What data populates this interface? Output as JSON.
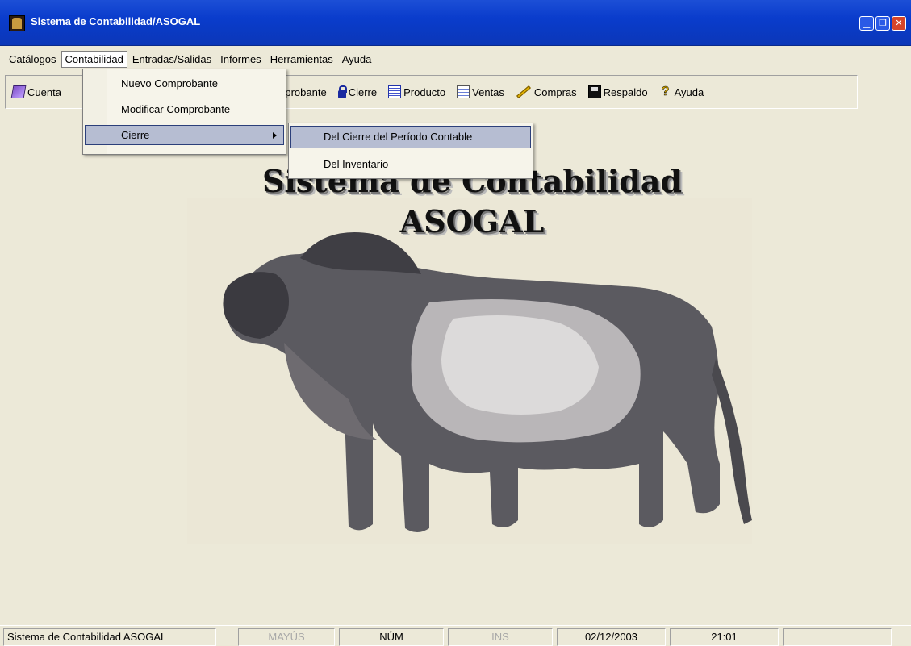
{
  "window": {
    "title": "Sistema de Contabilidad/ASOGAL",
    "buttons": [
      "▁",
      "❐",
      "✕"
    ]
  },
  "menubar": {
    "items": [
      {
        "label": "Catálogos"
      },
      {
        "label": "Contabilidad",
        "active": true
      },
      {
        "label": "Entradas/Salidas"
      },
      {
        "label": "Informes"
      },
      {
        "label": "Herramientas"
      },
      {
        "label": "Ayuda"
      }
    ]
  },
  "toolbar": {
    "cuentas": {
      "label": "Cuenta",
      "icon": "book-icon"
    },
    "comprobante": {
      "label": "Comprobante"
    },
    "cierre": {
      "label": "Cierre",
      "icon": "lock-icon"
    },
    "producto": {
      "label": "Producto",
      "icon": "product-icon"
    },
    "ventas": {
      "label": "Ventas",
      "icon": "sales-icon"
    },
    "compras": {
      "label": "Compras",
      "icon": "pencil-icon"
    },
    "respaldo": {
      "label": "Respaldo",
      "icon": "disk-icon"
    },
    "ayuda": {
      "label": "Ayuda",
      "icon": "help-icon",
      "glyph": "?"
    }
  },
  "contabilidad_menu": {
    "items": [
      {
        "label": "Nuevo Comprobante"
      },
      {
        "label": "Modificar Comprobante"
      },
      {
        "label": "Cierre",
        "submenu": true,
        "highlighted": true
      }
    ]
  },
  "cierre_submenu": {
    "items": [
      {
        "label": "Del Cierre del Período Contable",
        "highlighted": true
      },
      {
        "label": "Del Inventario"
      }
    ]
  },
  "main": {
    "heading_line1": "Sistema de Contabilidad",
    "heading_line2": "ASOGAL",
    "image_subject": "brahman-bull-photo"
  },
  "statusbar": {
    "app_name": "Sistema de Contabilidad ASOGAL",
    "caps": "MAYÚS",
    "num": "NÚM",
    "ins": "INS",
    "date": "02/12/2003",
    "time": "21:01",
    "extra": ""
  },
  "colors": {
    "titlebar": "#0a3ccc",
    "highlight": "#b6bdd2",
    "background": "#ece9d8"
  }
}
